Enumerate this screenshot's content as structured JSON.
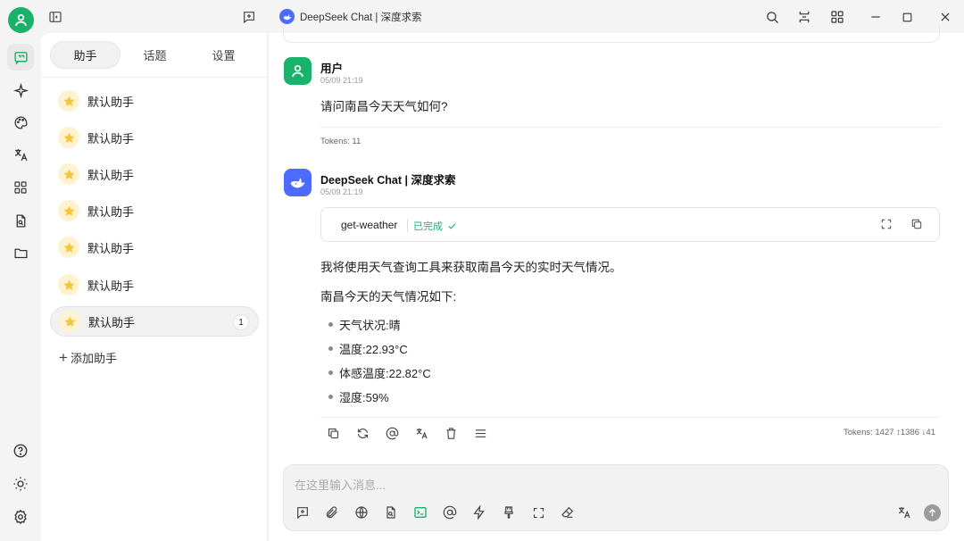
{
  "window": {
    "title": "DeepSeek Chat | 深度求索"
  },
  "sidebar": {
    "tabs": [
      {
        "label": "助手",
        "active": true
      },
      {
        "label": "话题",
        "active": false
      },
      {
        "label": "设置",
        "active": false
      }
    ],
    "assistants": [
      {
        "name": "默认助手",
        "emoji": "star"
      },
      {
        "name": "默认助手",
        "emoji": "star"
      },
      {
        "name": "默认助手",
        "emoji": "star"
      },
      {
        "name": "默认助手",
        "emoji": "star"
      },
      {
        "name": "默认助手",
        "emoji": "star"
      },
      {
        "name": "默认助手",
        "emoji": "star"
      },
      {
        "name": "默认助手",
        "emoji": "star",
        "selected": true,
        "badge": "1"
      }
    ],
    "add_label": "添加助手"
  },
  "messages": [
    {
      "sender": "用户",
      "time": "05/09 21:19",
      "text": "请问南昌今天天气如何?",
      "tokens": "Tokens: 11"
    },
    {
      "sender": "DeepSeek Chat | 深度求索",
      "time": "05/09 21:19",
      "tool": {
        "name": "get-weather",
        "status": "已完成"
      },
      "intro": "我将使用天气查询工具来获取南昌今天的实时天气情况。",
      "summary": "南昌今天的天气情况如下:",
      "bullets": [
        "天气状况:晴",
        "温度:22.93°C",
        "体感温度:22.82°C",
        "湿度:59%"
      ],
      "tokens": "Tokens: 1427 ↕1386 ↓41"
    }
  ],
  "composer": {
    "placeholder": "在这里输入消息..."
  },
  "colors": {
    "accent": "#19b26b",
    "deepseek": "#4d6bfe",
    "star": "#f5c53b"
  }
}
